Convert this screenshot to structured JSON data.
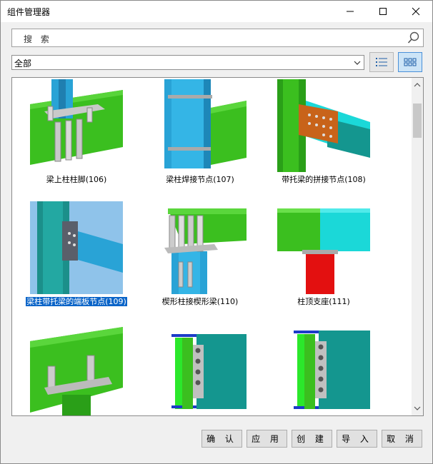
{
  "window": {
    "title": "组件管理器"
  },
  "search": {
    "placeholder": "搜 索"
  },
  "filter": {
    "selected": "全部"
  },
  "items": [
    {
      "label": "梁上柱柱脚(106)"
    },
    {
      "label": "梁柱焊接节点(107)"
    },
    {
      "label": "带托梁的拼接节点(108)"
    },
    {
      "label": "梁柱带托梁的端板节点(109)"
    },
    {
      "label": "楔形柱接楔形梁(110)"
    },
    {
      "label": "柱顶支座(111)"
    },
    {
      "label": ""
    },
    {
      "label": ""
    },
    {
      "label": ""
    }
  ],
  "buttons": {
    "confirm": "确 认",
    "apply": "应 用",
    "create": "创 建",
    "import": "导 入",
    "cancel": "取 消"
  },
  "colors": {
    "green": "#3bbf1f",
    "blue": "#29a3d6",
    "cyan": "#1bd8d8",
    "teal": "#14968f",
    "selection": "#0a64c8"
  }
}
